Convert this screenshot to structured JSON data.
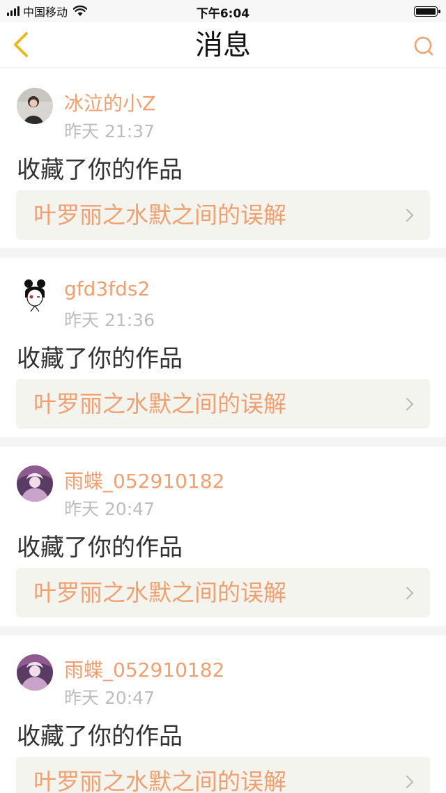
{
  "status_bar": {
    "carrier": "中国移动",
    "time": "下午6:04"
  },
  "nav": {
    "title": "消息",
    "back_icon": "chevron-left-icon",
    "search_icon": "search-icon"
  },
  "colors": {
    "accent": "#f0a070",
    "back_arrow": "#e8b923",
    "link_bg": "#f4f4ef",
    "divider": "#f4f4f4"
  },
  "messages": [
    {
      "username": "冰泣的小Z",
      "time": "昨天 21:37",
      "action": "收藏了你的作品",
      "work_title": "叶罗丽之水默之间的误解"
    },
    {
      "username": "gfd3fds2",
      "time": "昨天 21:36",
      "action": "收藏了你的作品",
      "work_title": "叶罗丽之水默之间的误解"
    },
    {
      "username": "雨蝶_052910182",
      "time": "昨天 20:47",
      "action": "收藏了你的作品",
      "work_title": "叶罗丽之水默之间的误解"
    },
    {
      "username": "雨蝶_052910182",
      "time": "昨天 20:47",
      "action": "收藏了你的作品",
      "work_title": "叶罗丽之水默之间的误解"
    }
  ]
}
